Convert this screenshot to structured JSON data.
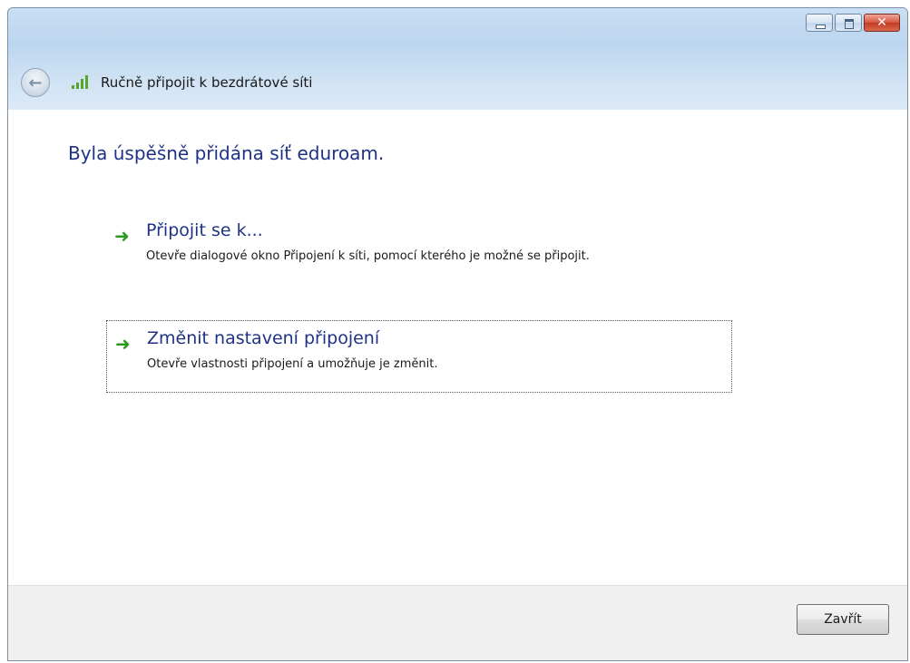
{
  "window": {
    "nav_title": "Ručně připojit k bezdrátové síti",
    "buttons": [
      "minimize",
      "maximize",
      "close"
    ]
  },
  "content": {
    "heading": "Byla úspěšně přidána síť eduroam.",
    "options": [
      {
        "title": "Připojit se k...",
        "description": "Otevře dialogové okno Připojení k síti, pomocí kterého je možné se připojit.",
        "icon": "green-arrow-icon"
      },
      {
        "title": "Změnit nastavení připojení",
        "description": "Otevře vlastnosti připojení a umožňuje je změnit.",
        "icon": "green-arrow-icon",
        "focused": true
      }
    ]
  },
  "footer": {
    "close_label": "Zavřít"
  },
  "colors": {
    "heading": "#1e3287",
    "arrow": "#2b9b1c",
    "titlebar": "#c9dff3"
  }
}
